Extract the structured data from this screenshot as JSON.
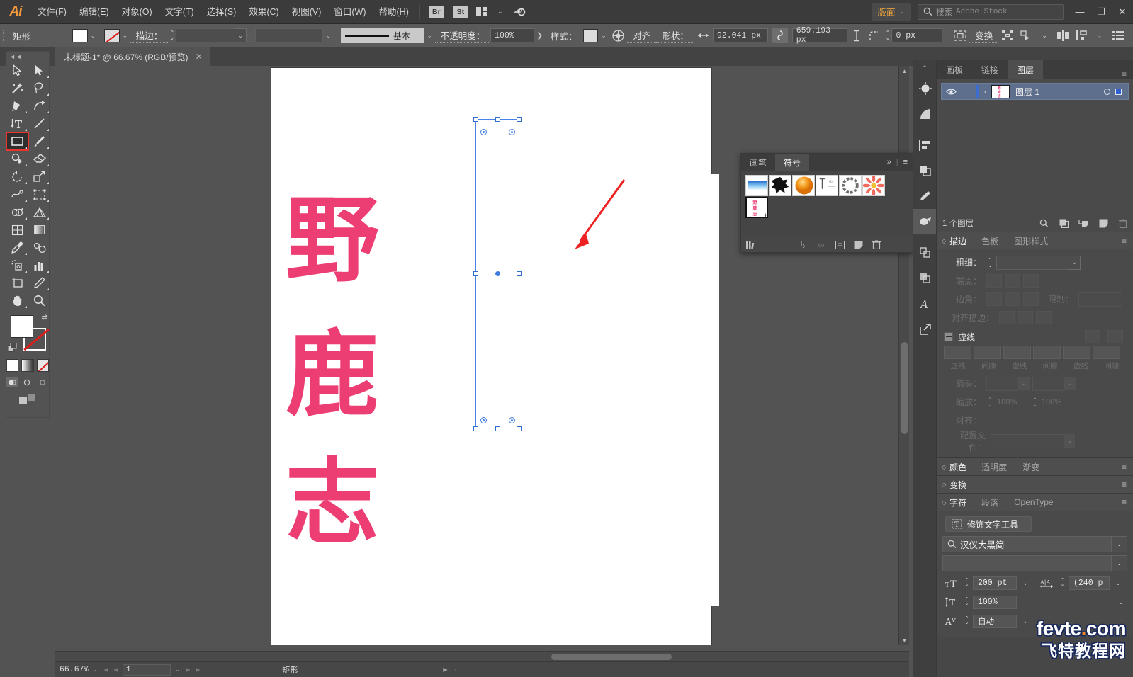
{
  "app": {
    "name": "Ai",
    "logo_color": "#f59b3c"
  },
  "menubar": {
    "items": [
      "文件(F)",
      "编辑(E)",
      "对象(O)",
      "文字(T)",
      "选择(S)",
      "效果(C)",
      "视图(V)",
      "窗口(W)",
      "帮助(H)"
    ],
    "bridge_badge": "Br",
    "stock_badge": "St",
    "arrange_label": "版面",
    "search_label": "搜索",
    "search_placeholder": "Adobe Stock",
    "minimize": "—",
    "maximize": "❐",
    "close": "✕"
  },
  "controlbar": {
    "tool_name": "矩形",
    "stroke_label": "描边：",
    "stroke_profile": "基本",
    "opacity_label": "不透明度：",
    "opacity_value": "100%",
    "style_label": "样式：",
    "align_label": "对齐",
    "shape_label": "形状：",
    "width_value": "92.041 px",
    "height_value": "659.193 px",
    "angle_value": "0 px",
    "transform_label": "变换"
  },
  "document": {
    "tab_title": "未标题-1* @ 66.67% (RGB/预览)",
    "close_glyph": "✕"
  },
  "toolbar": {
    "collapse_glyph": "◄◄",
    "tools": [
      {
        "name": "selection-tool"
      },
      {
        "name": "direct-selection-tool"
      },
      {
        "name": "magic-wand-tool"
      },
      {
        "name": "lasso-tool"
      },
      {
        "name": "pen-tool"
      },
      {
        "name": "curvature-tool"
      },
      {
        "name": "type-tool"
      },
      {
        "name": "line-segment-tool"
      },
      {
        "name": "rectangle-tool",
        "selected": true
      },
      {
        "name": "paintbrush-tool"
      },
      {
        "name": "shaper-tool"
      },
      {
        "name": "eraser-tool"
      },
      {
        "name": "rotate-tool"
      },
      {
        "name": "scale-tool"
      },
      {
        "name": "width-tool"
      },
      {
        "name": "free-transform-tool"
      },
      {
        "name": "shape-builder-tool"
      },
      {
        "name": "perspective-grid-tool"
      },
      {
        "name": "mesh-tool"
      },
      {
        "name": "gradient-tool"
      },
      {
        "name": "eyedropper-tool"
      },
      {
        "name": "blend-tool"
      },
      {
        "name": "symbol-sprayer-tool"
      },
      {
        "name": "column-graph-tool"
      },
      {
        "name": "artboard-tool"
      },
      {
        "name": "slice-tool"
      },
      {
        "name": "hand-tool"
      },
      {
        "name": "zoom-tool"
      }
    ],
    "fill_color": "#ffffff",
    "stroke_color": "none",
    "modes": [
      "color",
      "gradient",
      "none"
    ],
    "screen_modes": [
      "normal-screen",
      "full-screen-menu",
      "full-screen"
    ]
  },
  "canvas": {
    "artwork_chars": [
      "野",
      "鹿",
      "志"
    ],
    "art_color": "#ec3e72",
    "selection_color": "#4a83e8",
    "annotation_arrow_color": "#ee2222"
  },
  "symbol_panel": {
    "tabs": [
      "画笔",
      "符号"
    ],
    "active_tab": "符号",
    "expand_glyph": "»",
    "menu_glyph": "≡",
    "symbols": [
      {
        "name": "gradient-swatch-symbol"
      },
      {
        "name": "ink-splat-symbol"
      },
      {
        "name": "orange-sphere-symbol"
      },
      {
        "name": "ruler-symbol"
      },
      {
        "name": "rope-ring-symbol"
      },
      {
        "name": "flower-symbol"
      },
      {
        "name": "text-artwork-symbol",
        "selected": true
      }
    ],
    "footer_icons": [
      "symbol-libraries",
      "place-symbol-instance",
      "break-link",
      "symbol-options",
      "new-symbol",
      "delete-symbol"
    ]
  },
  "dock": {
    "layers": {
      "tabs": [
        "画板",
        "链接",
        "图层"
      ],
      "active_tab": "图层",
      "menu_glyph": "≡",
      "row": {
        "name": "图层 1",
        "expand_glyph": "›"
      },
      "footer_count": "1 个图层",
      "footer_icons": [
        "locate-object",
        "make-clipping-mask",
        "create-new-sublayer",
        "create-new-layer",
        "delete-selection"
      ]
    },
    "stroke_panel": {
      "tabs": [
        "描边",
        "色板",
        "图形样式"
      ],
      "active_tab": "描边",
      "weight_label": "粗细：",
      "weight_value": "",
      "cap_label": "端点：",
      "corner_label": "边角：",
      "limit_label": "限制：",
      "align_label": "对齐描边：",
      "dashed_label": "虚线",
      "dash_labels": [
        "虚线",
        "间隙",
        "虚线",
        "间隙",
        "虚线",
        "间隙"
      ],
      "arrow_label": "箭头：",
      "scale_label": "缩放：",
      "scale_v1": "100%",
      "scale_v2": "100%",
      "align_dash_label": "对齐：",
      "profile_label": "配置文件："
    },
    "color_panel": {
      "tabs": [
        "颜色",
        "透明度",
        "渐变"
      ],
      "active_tab": "颜色",
      "menu_glyph": "≡"
    },
    "transform_panel": {
      "tabs": [
        "变换"
      ],
      "active_tab": "变换",
      "menu_glyph": "≡"
    },
    "character_panel": {
      "tabs": [
        "字符",
        "段落",
        "OpenType"
      ],
      "active_tab": "字符",
      "menu_glyph": "≡",
      "touch_type_label": "修饰文字工具",
      "font_family": "汉仪大黑简",
      "font_style": "-",
      "font_size": "200 pt",
      "leading": "(240 p",
      "vertical_scale": "100%",
      "kerning": "自动"
    }
  },
  "statusbar": {
    "zoom": "66.67%",
    "page_number": "1",
    "tool_name": "矩形",
    "next_glyph": "▶",
    "prev_glyph": "‹"
  },
  "watermark": {
    "line1_a": "fevte",
    "line1_b": ".",
    "line1_c": "com",
    "line2": "飞特教程网"
  }
}
